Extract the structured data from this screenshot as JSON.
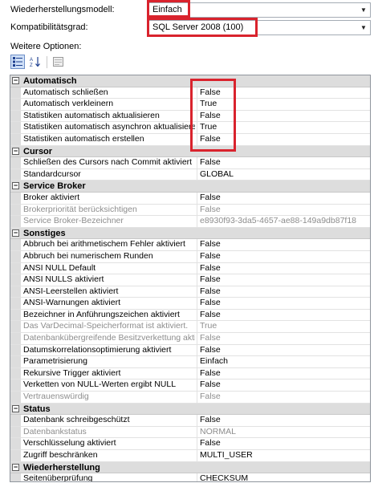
{
  "recovery_model": {
    "label": "Wiederherstellungsmodell:",
    "value": "Einfach"
  },
  "compatibility": {
    "label": "Kompatibilitätsgrad:",
    "value": "SQL Server 2008 (100)"
  },
  "more_options_label": "Weitere Optionen:",
  "sections": [
    {
      "title": "Automatisch",
      "rows": [
        {
          "name": "Automatisch schließen",
          "value": "False",
          "disabled": false
        },
        {
          "name": "Automatisch verkleinern",
          "value": "True",
          "disabled": false
        },
        {
          "name": "Statistiken automatisch aktualisieren",
          "value": "False",
          "disabled": false
        },
        {
          "name": "Statistiken automatisch asynchron aktualisieren",
          "value": "True",
          "disabled": false
        },
        {
          "name": "Statistiken automatisch erstellen",
          "value": "False",
          "disabled": false
        }
      ]
    },
    {
      "title": "Cursor",
      "rows": [
        {
          "name": "Schließen des Cursors nach Commit aktiviert",
          "value": "False",
          "disabled": false
        },
        {
          "name": "Standardcursor",
          "value": "GLOBAL",
          "disabled": false
        }
      ]
    },
    {
      "title": "Service Broker",
      "rows": [
        {
          "name": "Broker aktiviert",
          "value": "False",
          "disabled": false
        },
        {
          "name": "Brokerpriorität berücksichtigen",
          "value": "False",
          "disabled": true
        },
        {
          "name": "Service Broker-Bezeichner",
          "value": "e8930f93-3da5-4657-ae88-149a9db87f18",
          "disabled": true
        }
      ]
    },
    {
      "title": "Sonstiges",
      "rows": [
        {
          "name": "Abbruch bei arithmetischem Fehler aktiviert",
          "value": "False",
          "disabled": false
        },
        {
          "name": "Abbruch bei numerischem Runden",
          "value": "False",
          "disabled": false
        },
        {
          "name": "ANSI NULL Default",
          "value": "False",
          "disabled": false
        },
        {
          "name": "ANSI NULLS aktiviert",
          "value": "False",
          "disabled": false
        },
        {
          "name": "ANSI-Leerstellen aktiviert",
          "value": "False",
          "disabled": false
        },
        {
          "name": "ANSI-Warnungen aktiviert",
          "value": "False",
          "disabled": false
        },
        {
          "name": "Bezeichner in Anführungszeichen aktiviert",
          "value": "False",
          "disabled": false
        },
        {
          "name": "Das VarDecimal-Speicherformat ist aktiviert.",
          "value": "True",
          "disabled": true
        },
        {
          "name": "Datenbankübergreifende Besitzverkettung aktiviert",
          "value": "False",
          "disabled": true
        },
        {
          "name": "Datumskorrelationsoptimierung aktiviert",
          "value": "False",
          "disabled": false
        },
        {
          "name": "Parametrisierung",
          "value": "Einfach",
          "disabled": false
        },
        {
          "name": "Rekursive Trigger aktiviert",
          "value": "False",
          "disabled": false
        },
        {
          "name": "Verketten von NULL-Werten ergibt NULL",
          "value": "False",
          "disabled": false
        },
        {
          "name": "Vertrauenswürdig",
          "value": "False",
          "disabled": true
        }
      ]
    },
    {
      "title": "Status",
      "rows": [
        {
          "name": "Datenbank schreibgeschützt",
          "value": "False",
          "disabled": false
        },
        {
          "name": "Datenbankstatus",
          "value": "NORMAL",
          "disabled": true
        },
        {
          "name": "Verschlüsselung aktiviert",
          "value": "False",
          "disabled": false
        },
        {
          "name": "Zugriff beschränken",
          "value": "MULTI_USER",
          "disabled": false
        }
      ]
    },
    {
      "title": "Wiederherstellung",
      "rows": [
        {
          "name": "Seitenüberprüfung",
          "value": "CHECKSUM",
          "disabled": false
        }
      ]
    }
  ],
  "toggle_symbol": "⊟",
  "highlight_color": "#d9232d"
}
